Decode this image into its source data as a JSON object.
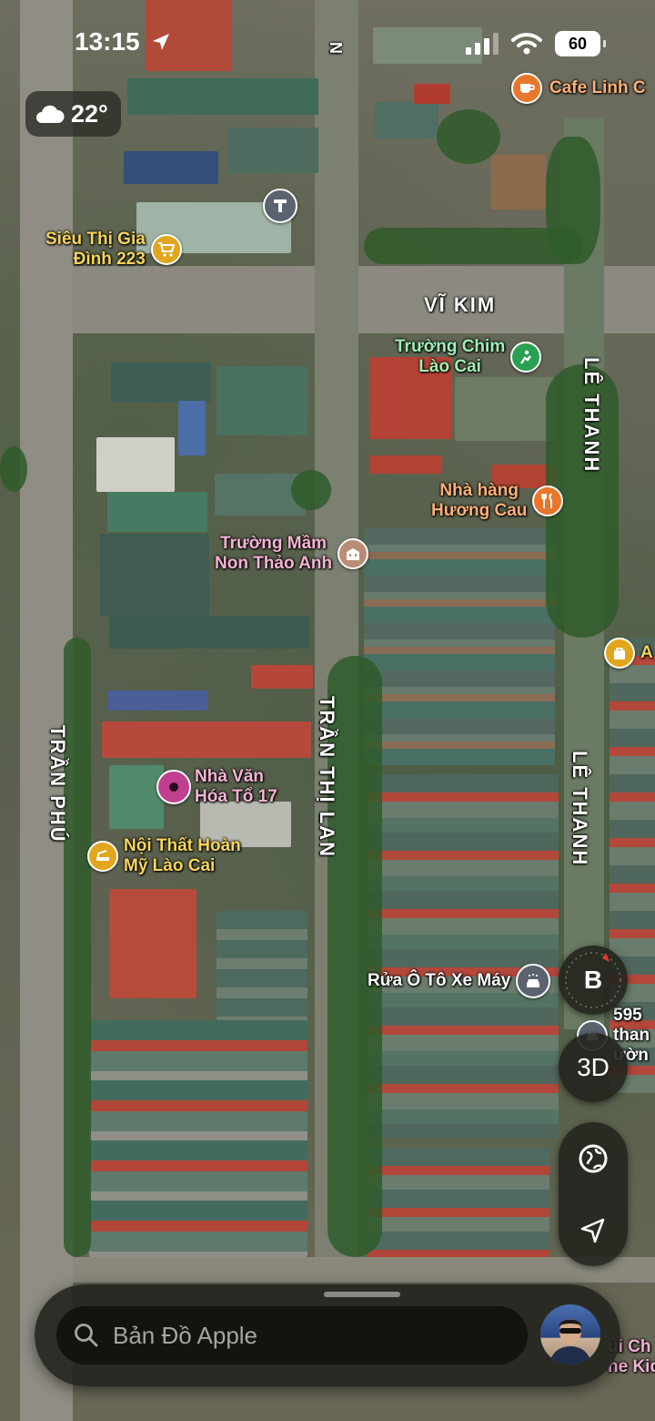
{
  "status_bar": {
    "time": "13:15",
    "battery": "60"
  },
  "weather": {
    "temperature": "22°",
    "icon": "cloud-icon"
  },
  "streets": {
    "vi_kim": "VĨ KIM",
    "le_thanh_top": "LÊ THANH",
    "le_thanh_bottom": "LÊ THANH",
    "tran_thi_lan": "TRẦN THỊ LAN",
    "tran_phu": "TRẦN PHÚ",
    "top_edge": "N"
  },
  "pois": {
    "cafe": {
      "label": "Cafe Linh C",
      "icon": "coffee-cup-icon",
      "color": "#e8762b"
    },
    "transit": {
      "label": "",
      "icon": "train-icon",
      "color": "#5b6270"
    },
    "supermarket": {
      "line1": "Siêu Thị Gia",
      "line2": "Đình 223",
      "icon": "shopping-cart-icon",
      "color": "#e2a61d"
    },
    "school_bird": {
      "line1": "Trường Chim",
      "line2": "Lào Cai",
      "icon": "school-icon",
      "color": "#2aa152"
    },
    "restaurant": {
      "line1": "Nhà hàng",
      "line2": "Hương Cau",
      "icon": "fork-knife-icon",
      "color": "#e8762b"
    },
    "kindergarten": {
      "line1": "Trường Mầm",
      "line2": "Non Thảo Anh",
      "icon": "building-icon",
      "color": "#b98c75"
    },
    "shop_right": {
      "label": "A",
      "icon": "bag-icon",
      "color": "#e2a61d"
    },
    "culture_house": {
      "line1": "Nhà Văn",
      "line2": "Hóa Tổ 17",
      "icon": "dot-marker-icon",
      "color": "#c0408f"
    },
    "furniture": {
      "line1": "Nội Thất Hoàn",
      "line2": "Mỹ Lào Cai",
      "icon": "sofa-icon",
      "color": "#e2a61d"
    },
    "car_wash": {
      "label": "Rửa Ô Tô Xe Máy",
      "icon": "car-wash-icon",
      "color": "#5b6270"
    },
    "partial_595": {
      "line1": "595",
      "line2": "than",
      "line3": "ườn",
      "icon": "car-icon",
      "color": "#5b6270"
    },
    "partial_bottom": {
      "line1": "ui Ch",
      "line2": "ne Kid"
    }
  },
  "controls": {
    "compass": "B",
    "three_d": "3D",
    "globe_icon": "globe-icon",
    "locate_icon": "location-arrow-icon"
  },
  "search": {
    "placeholder": "Bản Đồ Apple",
    "icon": "search-icon"
  }
}
